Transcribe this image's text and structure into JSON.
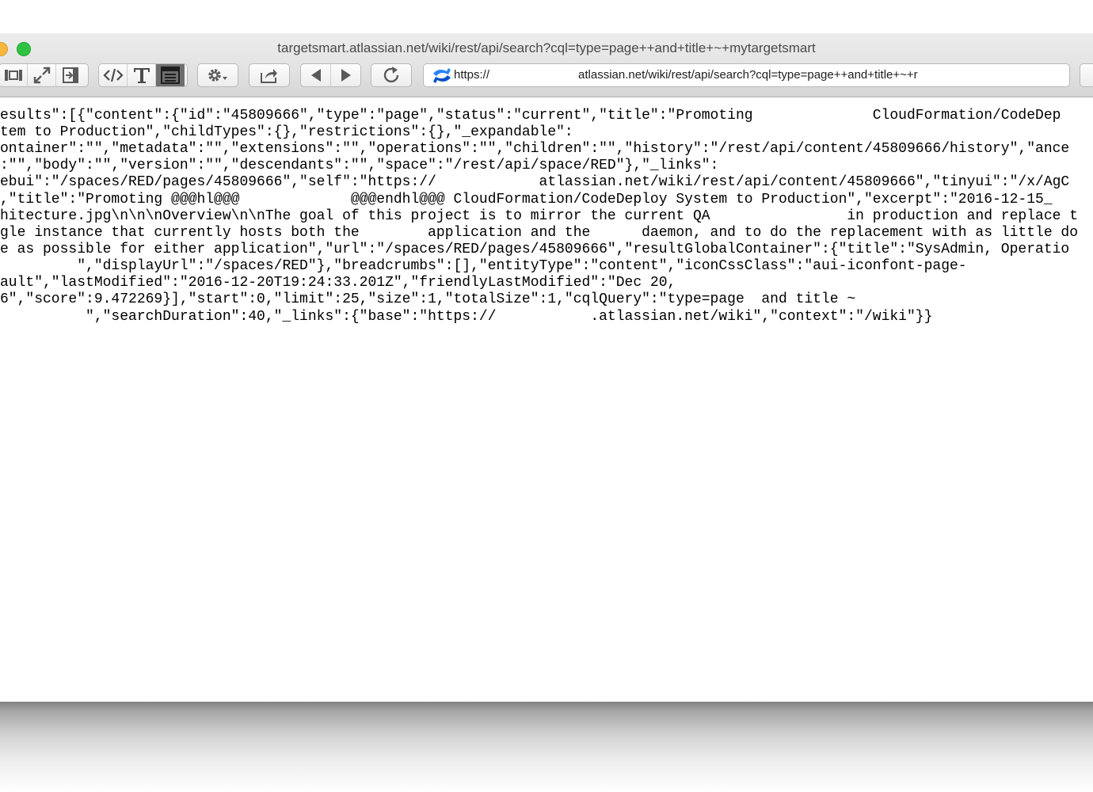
{
  "window": {
    "title": "targetsmart.atlassian.net/wiki/rest/api/search?cql=type=page++and+title+~+mytargetsmart"
  },
  "toolbar": {
    "buttons": [
      {
        "name": "sidebar-layout-button",
        "icon": "layout-icon"
      },
      {
        "name": "fullscreen-button",
        "icon": "expand-arrows-icon"
      },
      {
        "name": "open-in-panel-button",
        "icon": "panel-arrow-icon"
      },
      {
        "name": "view-source-button",
        "icon": "code-icon"
      },
      {
        "name": "text-format-button",
        "icon": "text-t-icon"
      },
      {
        "name": "reader-view-button",
        "icon": "reader-icon"
      },
      {
        "name": "settings-button",
        "icon": "gear-icon"
      },
      {
        "name": "share-button",
        "icon": "share-icon"
      },
      {
        "name": "back-button",
        "icon": "triangle-left-icon"
      },
      {
        "name": "forward-button",
        "icon": "triangle-right-icon"
      },
      {
        "name": "reload-button",
        "icon": "reload-icon"
      }
    ]
  },
  "address": {
    "prefix": "https://",
    "suffix": "atlassian.net/wiki/rest/api/search?cql=type=page++and+title+~+r",
    "site_icon": "confluence-icon"
  },
  "content": {
    "lines": [
      "esults\":[{\"content\":{\"id\":\"45809666\",\"type\":\"page\",\"status\":\"current\",\"title\":\"Promoting              CloudFormation/CodeDep",
      "tem to Production\",\"childTypes\":{},\"restrictions\":{},\"_expandable\":",
      "ontainer\":\"\",\"metadata\":\"\",\"extensions\":\"\",\"operations\":\"\",\"children\":\"\",\"history\":\"/rest/api/content/45809666/history\",\"ance",
      ":\"\",\"body\":\"\",\"version\":\"\",\"descendants\":\"\",\"space\":\"/rest/api/space/RED\"},\"_links\":",
      "ebui\":\"/spaces/RED/pages/45809666\",\"self\":\"https://            atlassian.net/wiki/rest/api/content/45809666\",\"tinyui\":\"/x/AgC",
      ",\"title\":\"Promoting @@@hl@@@             @@@endhl@@@ CloudFormation/CodeDeploy System to Production\",\"excerpt\":\"2016-12-15_",
      "hitecture.jpg\\n\\n\\nOverview\\n\\nThe goal of this project is to mirror the current QA                in production and replace t",
      "gle instance that currently hosts both the        application and the      daemon, and to do the replacement with as little do",
      "e as possible for either application\",\"url\":\"/spaces/RED/pages/45809666\",\"resultGlobalContainer\":{\"title\":\"SysAdmin, Operatio",
      "         \",\"displayUrl\":\"/spaces/RED\"},\"breadcrumbs\":[],\"entityType\":\"content\",\"iconCssClass\":\"aui-iconfont-page-",
      "ault\",\"lastModified\":\"2016-12-20T19:24:33.201Z\",\"friendlyLastModified\":\"Dec 20,",
      "6\",\"score\":9.472269}],\"start\":0,\"limit\":25,\"size\":1,\"totalSize\":1,\"cqlQuery\":\"type=page  and title ~",
      "          \",\"searchDuration\":40,\"_links\":{\"base\":\"https://           .atlassian.net/wiki\",\"context\":\"/wiki\"}}"
    ]
  }
}
